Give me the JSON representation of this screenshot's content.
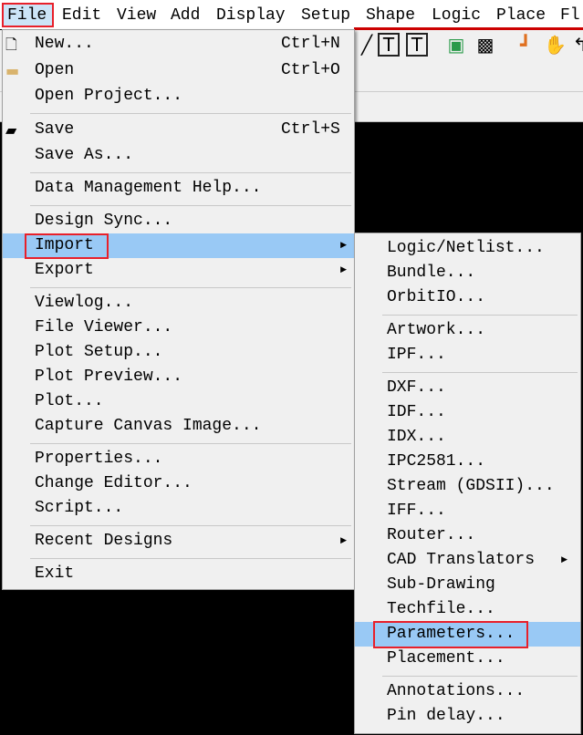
{
  "menubar": [
    "File",
    "Edit",
    "View",
    "Add",
    "Display",
    "Setup",
    "Shape",
    "Logic",
    "Place",
    "Fl"
  ],
  "file_menu": {
    "new": {
      "label": "New...",
      "shortcut": "Ctrl+N"
    },
    "open": {
      "label": "Open",
      "shortcut": "Ctrl+O"
    },
    "open_project": "Open Project...",
    "save": {
      "label": "Save",
      "shortcut": "Ctrl+S"
    },
    "save_as": "Save As...",
    "data_mgmt": "Data Management Help...",
    "design_sync": "Design Sync...",
    "import": "Import",
    "export": "Export",
    "viewlog": "Viewlog...",
    "file_viewer": "File Viewer...",
    "plot_setup": "Plot Setup...",
    "plot_preview": "Plot Preview...",
    "plot": "Plot...",
    "capture": "Capture Canvas Image...",
    "properties": "Properties...",
    "change_editor": "Change Editor...",
    "script": "Script...",
    "recent": "Recent Designs",
    "exit": "Exit"
  },
  "import_menu": [
    "Logic/Netlist...",
    "Bundle...",
    "OrbitIO...",
    "Artwork...",
    "IPF...",
    "DXF...",
    "IDF...",
    "IDX...",
    "IPC2581...",
    "Stream (GDSII)...",
    "IFF...",
    "Router...",
    "CAD Translators",
    "Sub-Drawing",
    "Techfile...",
    "Parameters...",
    "Placement...",
    "Annotations...",
    "Pin delay..."
  ],
  "colors": {
    "highlight": "#99c9f5",
    "callout": "#e8202a"
  }
}
